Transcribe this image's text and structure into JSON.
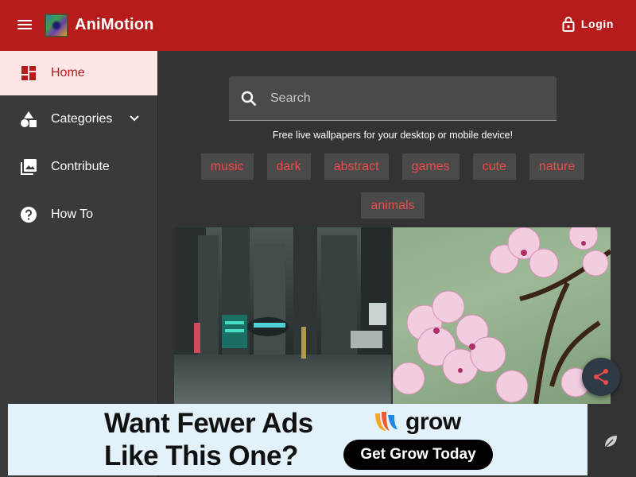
{
  "header": {
    "app_title": "AniMotion",
    "login_label": "Login",
    "background_color": "#b71c1c"
  },
  "sidebar": {
    "items": [
      {
        "label": "Home",
        "icon": "dashboard-icon",
        "active": true
      },
      {
        "label": "Categories",
        "icon": "shapes-icon",
        "expandable": true
      },
      {
        "label": "Contribute",
        "icon": "image-icon"
      },
      {
        "label": "How To",
        "icon": "help-icon"
      }
    ]
  },
  "main": {
    "search_placeholder": "Search",
    "tagline": "Free live wallpapers for your desktop or mobile device!",
    "tags": [
      "music",
      "dark",
      "abstract",
      "games",
      "cute",
      "nature",
      "animals"
    ],
    "wallpapers": [
      {
        "subject": "cyberpunk-city-street"
      },
      {
        "subject": "cherry-blossoms"
      }
    ]
  },
  "ad": {
    "headline_line1": "Want Fewer Ads",
    "headline_line2": "Like This One?",
    "brand": "grow",
    "cta_label": "Get Grow Today"
  },
  "colors": {
    "accent": "#b71c1c",
    "tag_text": "#ef4b4b",
    "active_nav_bg": "#ffe5e5"
  }
}
